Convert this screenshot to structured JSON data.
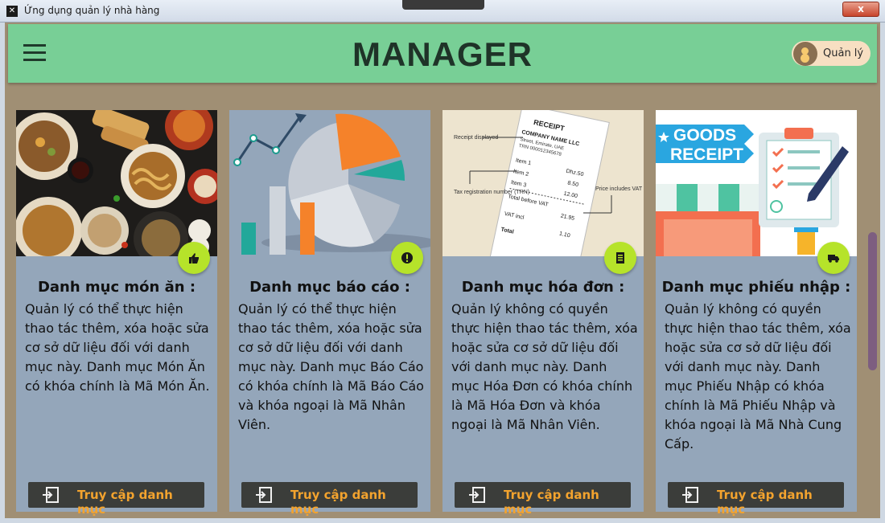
{
  "window": {
    "title": "Ứng dụng quản lý nhà hàng",
    "close_label": "x"
  },
  "header": {
    "title": "MANAGER",
    "user_role": "Quản lý"
  },
  "cards": [
    {
      "title": "Danh mục món ăn :",
      "description": "Quản lý có thể thực hiện thao tác thêm, xóa hoặc sửa cơ sở dữ liệu đối với danh mục này. Danh mục Món Ăn có khóa chính là Mã Món Ăn.",
      "badge_icon": "thumb-up-icon",
      "button_label": "Truy cập danh mục"
    },
    {
      "title": "Danh mục báo cáo :",
      "description": "Quản lý có thể thực hiện thao tác thêm, xóa hoặc sửa cơ sở dữ liệu đối với danh mục này. Danh mục Báo Cáo có khóa chính là Mã Báo Cáo và khóa ngoại là Mã Nhân Viên.",
      "badge_icon": "alert-icon",
      "button_label": "Truy cập danh mục"
    },
    {
      "title": "Danh mục hóa đơn :",
      "description": "Quản lý không có quyền thực hiện thao tác thêm, xóa hoặc sửa cơ sở dữ liệu đối với danh mục này. Danh mục Hóa Đơn có khóa chính là Mã Hóa Đơn và khóa ngoại là Mã Nhân Viên.",
      "badge_icon": "receipt-icon",
      "button_label": "Truy cập danh mục"
    },
    {
      "title": "Danh mục phiếu nhập :",
      "description": "Quản lý không có quyền thực hiện thao tác thêm, xóa hoặc sửa cơ sở dữ liệu đối với danh mục này. Danh mục Phiếu Nhập có khóa chính là Mã Phiếu Nhập và khóa ngoại là Mã Nhà Cung Cấp.",
      "badge_icon": "truck-icon",
      "button_label": "Truy cập danh mục"
    }
  ],
  "images": {
    "receipt": {
      "heading": "RECEIPT",
      "company": "COMPANY NAME LLC",
      "address": "Street, Emirate, UAE",
      "trn": "TRN 000012345678",
      "items": [
        {
          "name": "Item 1",
          "price": "Dhz.50"
        },
        {
          "name": "Item 2",
          "price": "8.50"
        },
        {
          "name": "Item 3",
          "price": "12.00"
        }
      ],
      "total_before_vat_label": "Total before VAT",
      "total_before_vat": "21.95",
      "vat_label": "VAT incl",
      "vat": "1.10",
      "total_label": "Total",
      "callout_displayed": "Receipt displayed",
      "callout_trn": "Tax registration number (TRN)",
      "callout_price": "Price includes VAT"
    },
    "goods_receipt": {
      "line1": "GOODS",
      "line2": "RECEIPT"
    }
  },
  "colors": {
    "header_bg": "#78cf96",
    "card_bg": "#94a6ba",
    "badge_bg": "#b6e32a",
    "button_bg": "#3b3d3a",
    "button_text": "#f3a32e",
    "window_bg": "#a08f74"
  }
}
